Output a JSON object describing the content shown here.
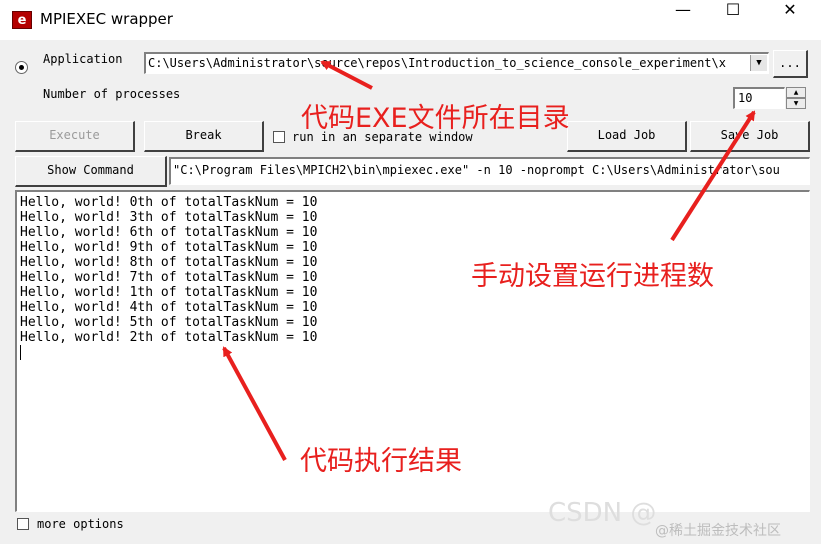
{
  "window": {
    "title": "MPIEXEC wrapper",
    "icon_letter": "e",
    "minimize_glyph": "—",
    "maximize_glyph": "☐",
    "close_glyph": "✕"
  },
  "application": {
    "label": "Application",
    "path": "C:\\Users\\Administrator\\source\\repos\\Introduction_to_science_console_experiment\\x",
    "browse_label": "..."
  },
  "processes": {
    "label": "Number of processes",
    "value": "10"
  },
  "buttons": {
    "execute": "Execute",
    "break": "Break",
    "load_job": "Load Job",
    "save_job": "Save Job",
    "show_command": "Show Command"
  },
  "options": {
    "separate_window": "run in an separate window",
    "more_options": "more options"
  },
  "command_line": "\"C:\\Program Files\\MPICH2\\bin\\mpiexec.exe\" -n 10  -noprompt C:\\Users\\Administrator\\sou",
  "output_lines": [
    "Hello, world! 0th of totalTaskNum = 10",
    "Hello, world! 3th of totalTaskNum = 10",
    "Hello, world! 6th of totalTaskNum = 10",
    "Hello, world! 9th of totalTaskNum = 10",
    "Hello, world! 8th of totalTaskNum = 10",
    "Hello, world! 7th of totalTaskNum = 10",
    "Hello, world! 1th of totalTaskNum = 10",
    "Hello, world! 4th of totalTaskNum = 10",
    "Hello, world! 5th of totalTaskNum = 10",
    "Hello, world! 2th of totalTaskNum = 10"
  ],
  "annotations": {
    "exe_dir": "代码EXE文件所在目录",
    "set_procs": "手动设置运行进程数",
    "result": "代码执行结果"
  },
  "watermark": {
    "main": "CSDN @",
    "sub": "@稀土掘金技术社区"
  },
  "colors": {
    "annotation": "#e8201e",
    "disabled_text": "#9a9a9a"
  }
}
